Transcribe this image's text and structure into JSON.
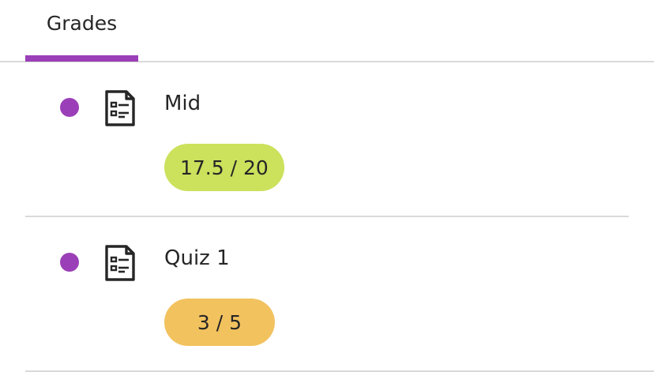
{
  "tabs": [
    {
      "label": "Grades",
      "active": true
    }
  ],
  "accent_color": "#9b3fb8",
  "items": [
    {
      "title": "Mid",
      "score": "17.5 / 20",
      "score_status": "good",
      "score_color": "#cce15c",
      "icon": "document-icon",
      "unread": true
    },
    {
      "title": "Quiz 1",
      "score": "3 / 5",
      "score_status": "warn",
      "score_color": "#f2c25f",
      "icon": "document-icon",
      "unread": true
    }
  ]
}
